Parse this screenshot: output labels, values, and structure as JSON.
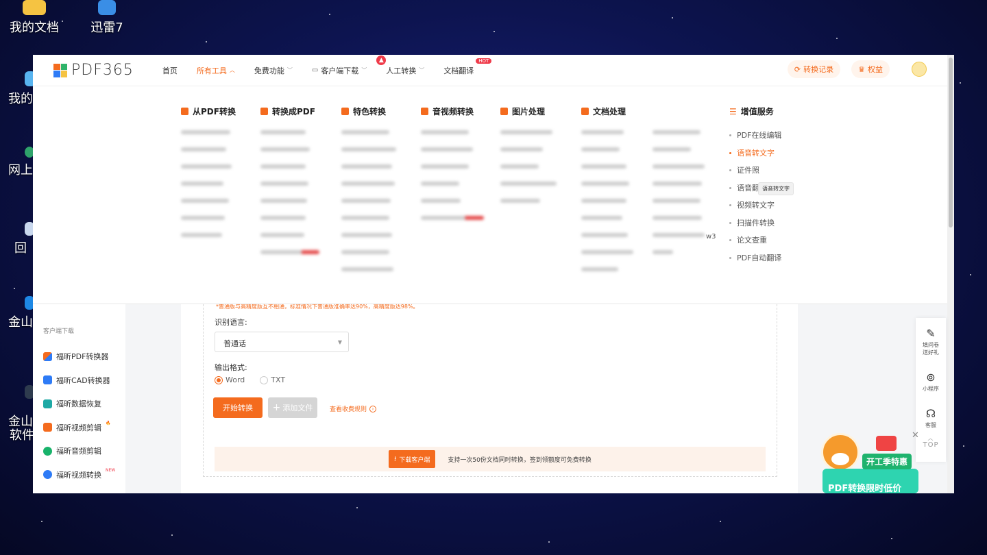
{
  "desktop": {
    "icons": [
      {
        "label": "我的文档"
      },
      {
        "label": "迅雷7"
      },
      {
        "label": "我的"
      },
      {
        "label": "网上"
      },
      {
        "label": "回"
      },
      {
        "label": "金山"
      },
      {
        "label": "金山\n软件"
      }
    ]
  },
  "topnav": {
    "logo": "PDF365",
    "items": [
      {
        "label": "首页"
      },
      {
        "label": "所有工具"
      },
      {
        "label": "免费功能"
      },
      {
        "label": "客户端下载"
      },
      {
        "label": "人工转换"
      },
      {
        "label": "文档翻译",
        "badge": "HOT"
      }
    ],
    "history_label": "转换记录",
    "benefits_label": "权益"
  },
  "mega": {
    "columns": [
      {
        "title": "从PDF转换"
      },
      {
        "title": "转换成PDF"
      },
      {
        "title": "特色转换"
      },
      {
        "title": "音视频转换"
      },
      {
        "title": "图片处理"
      },
      {
        "title": "文档处理"
      }
    ],
    "extra_text": "w3",
    "services": {
      "title": "增值服务",
      "items": [
        "PDF在线编辑",
        "语音转文字",
        "证件照",
        "语音翻译",
        "视频转文字",
        "扫描件转换",
        "论文查重",
        "PDF自动翻译"
      ],
      "active_index": 1
    },
    "tooltip": "语音转文字"
  },
  "sidebar": {
    "title": "客户端下载",
    "items": [
      {
        "label": "福昕PDF转换器",
        "color": "#4aa3ff"
      },
      {
        "label": "福昕CAD转换器",
        "color": "#2e7bf6"
      },
      {
        "label": "福昕数据恢复",
        "color": "#1ea9a5"
      },
      {
        "label": "福昕视频剪辑",
        "color": "#f46b1e",
        "badge": "🔥"
      },
      {
        "label": "福昕音频剪辑",
        "color": "#19b36b"
      },
      {
        "label": "福昕视频转换",
        "color": "#2e7bf6",
        "badge": "NEW"
      }
    ]
  },
  "main": {
    "note": "*普通版与高精度版互不相通，标准情况下普通版准确率达90%，高精度版达98%。",
    "language_label": "识别语言:",
    "language_value": "普通话",
    "format_label": "输出格式:",
    "formats": [
      "Word",
      "TXT"
    ],
    "selected_format": "Word",
    "start_button": "开始转换",
    "add_button": "添加文件",
    "rules_link": "查看收费规则",
    "download_button": "下载客户端",
    "download_text": "支持一次50份文档同时转换，签到领额度可免费转换"
  },
  "floatbar": {
    "items": [
      {
        "label": "填问卷\n送好礼",
        "icon": "form-icon"
      },
      {
        "label": "小程序",
        "icon": "miniprogram-icon"
      },
      {
        "label": "客服",
        "icon": "headset-icon"
      }
    ],
    "top_label": "TOP"
  },
  "promo": {
    "tag": "开工季特惠",
    "band": "PDF转换限时低价"
  },
  "colors": {
    "accent": "#f46b1e",
    "hot": "#ef3b4a"
  }
}
